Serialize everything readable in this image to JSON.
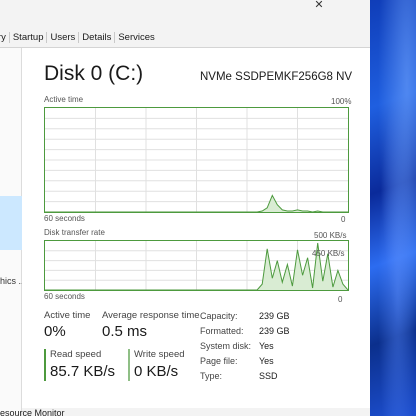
{
  "tabs": [
    "tory",
    "Startup",
    "Users",
    "Details",
    "Services"
  ],
  "close_glyph": "✕",
  "left_pane": {
    "truncated_label": "hics ..."
  },
  "footer": {
    "resource_monitor_link": "esource Monitor"
  },
  "disk": {
    "title": "Disk 0 (C:)",
    "model": "NVMe SSDPEMKF256G8 NV"
  },
  "active_time_chart": {
    "label": "Active time",
    "max_label": "100%",
    "left_time_label": "60 seconds",
    "min_label": "0"
  },
  "transfer_chart": {
    "label": "Disk transfer rate",
    "max_label": "500 KB/s",
    "secondary_label": "450 KB/s",
    "left_time_label": "60 seconds",
    "min_label": "0"
  },
  "stats": {
    "active_time": {
      "label": "Active time",
      "value": "0%"
    },
    "avg_response": {
      "label": "Average response time",
      "value": "0.5 ms"
    },
    "read_speed": {
      "label": "Read speed",
      "value": "85.7 KB/s"
    },
    "write_speed": {
      "label": "Write speed",
      "value": "0 KB/s"
    }
  },
  "properties": [
    {
      "key": "Capacity:",
      "value": "239 GB"
    },
    {
      "key": "Formatted:",
      "value": "239 GB"
    },
    {
      "key": "System disk:",
      "value": "Yes"
    },
    {
      "key": "Page file:",
      "value": "Yes"
    },
    {
      "key": "Type:",
      "value": "SSD"
    }
  ],
  "colors": {
    "disk_green": "#4d9a3e",
    "graph_fill": "#d9ecd3",
    "grid": "#e0e0e0",
    "read_bar": "#4d9a3e",
    "write_bar": "#8fbf86"
  },
  "chart_data": [
    {
      "type": "area",
      "title": "Active time",
      "xlabel": "60 seconds",
      "ylim": [
        0,
        100
      ],
      "series": [
        {
          "values": [
            0,
            0,
            0,
            0,
            0,
            0,
            0,
            0,
            0,
            0,
            0,
            0,
            0,
            0,
            0,
            0,
            0,
            0,
            0,
            0,
            0,
            0,
            0,
            0,
            0,
            0,
            0,
            0,
            0,
            0,
            0,
            0,
            0,
            0,
            0,
            0,
            0,
            0,
            0,
            0,
            0,
            0,
            0,
            1,
            4,
            16,
            7,
            2,
            1,
            1,
            2,
            1,
            1,
            0,
            1,
            0,
            0,
            0,
            0,
            0,
            0
          ]
        }
      ]
    },
    {
      "type": "area",
      "title": "Disk transfer rate",
      "xlabel": "60 seconds",
      "ylim": [
        0,
        500
      ],
      "series": [
        {
          "values": [
            0,
            0,
            0,
            0,
            0,
            0,
            0,
            0,
            0,
            0,
            0,
            0,
            0,
            0,
            0,
            0,
            0,
            0,
            0,
            0,
            0,
            0,
            0,
            0,
            0,
            0,
            0,
            0,
            0,
            0,
            0,
            0,
            0,
            0,
            0,
            0,
            0,
            0,
            0,
            0,
            0,
            0,
            0,
            60,
            420,
            120,
            300,
            80,
            260,
            40,
            410,
            150,
            330,
            20,
            480,
            90,
            370,
            30,
            200,
            60,
            0
          ]
        }
      ]
    }
  ]
}
